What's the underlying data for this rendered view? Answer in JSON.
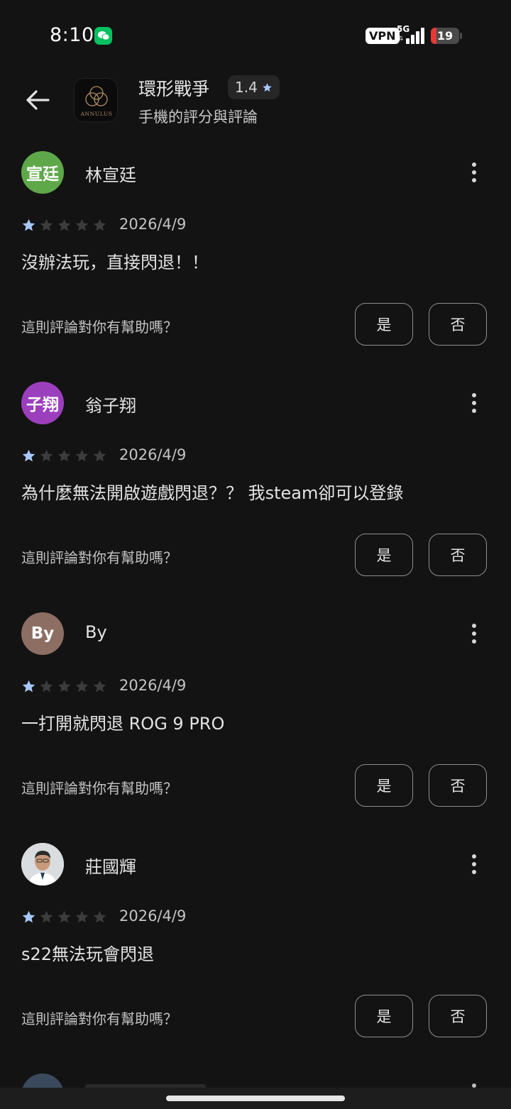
{
  "status_bar": {
    "time": "8:10",
    "vpn": "VPN",
    "network": "5G",
    "network_arrows": "⇅",
    "battery_level": "19",
    "battery_fraction": 0.19,
    "battery_color": "#e53935",
    "icons": [
      "wechat-notification-icon",
      "signal-icon",
      "battery-icon"
    ]
  },
  "header": {
    "app_title": "環形戰爭",
    "rating": "1.4",
    "subtitle": "手機的評分與評論",
    "app_icon_text": "ANNULUS",
    "back_icon": "arrow-back-icon"
  },
  "colors": {
    "background": "#131313",
    "star_filled": "#a8c7fa",
    "star_empty": "#3c3c3c"
  },
  "reviews": [
    {
      "name": "林宣廷",
      "avatar_text": "宣廷",
      "avatar_color": "#5fa84a",
      "stars": 1,
      "date": "2026/4/9",
      "text": "沒辦法玩，直接閃退！！",
      "helpful_question": "這則評論對你有幫助嗎？",
      "yes": "是",
      "no": "否"
    },
    {
      "name": "翁子翔",
      "avatar_text": "子翔",
      "avatar_color": "#9c3fbd",
      "stars": 1,
      "date": "2026/4/9",
      "text": "為什麼無法開啟遊戲閃退？？ 我steam卻可以登錄",
      "helpful_question": "這則評論對你有幫助嗎？",
      "yes": "是",
      "no": "否"
    },
    {
      "name": "By",
      "avatar_text": "By",
      "avatar_color": "#8d6e63",
      "stars": 1,
      "date": "2026/4/9",
      "text": "一打開就閃退 ROG 9 PRO",
      "helpful_question": "這則評論對你有幫助嗎？",
      "yes": "是",
      "no": "否"
    },
    {
      "name": "莊國輝",
      "avatar_text": "",
      "avatar_color": "#cfd4d8",
      "stars": 1,
      "date": "2026/4/9",
      "text": "s22無法玩會閃退",
      "helpful_question": "這則評論對你有幫助嗎？",
      "yes": "是",
      "no": "否"
    }
  ]
}
